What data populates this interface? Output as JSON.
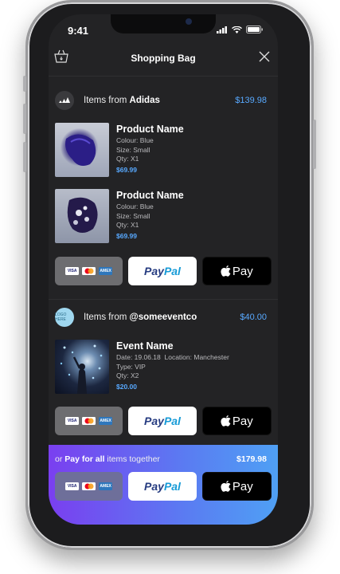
{
  "status_bar": {
    "time": "9:41"
  },
  "header": {
    "title": "Shopping Bag",
    "bag_icon": "shopping-bag-icon",
    "close_icon": "close-icon"
  },
  "shops": [
    {
      "label_prefix": "Items from",
      "name": "Adidas",
      "logo_text": "adidas",
      "total": "$139.98",
      "items": [
        {
          "name": "Product Name",
          "colour": "Colour: Blue",
          "size": "Size: Small",
          "qty": "Qty: X1",
          "price": "$69.99"
        },
        {
          "name": "Product Name",
          "colour": "Colour: Blue",
          "size": "Size: Small",
          "qty": "Qty: X1",
          "price": "$69.99"
        }
      ]
    },
    {
      "label_prefix": "Items from",
      "name": "@someeventco",
      "logo_text": "LOGO HERE",
      "total": "$40.00",
      "items": [
        {
          "name": "Event Name",
          "date": "Date: 19.06.18",
          "location": "Location: Manchester",
          "type": "Type: VIP",
          "qty": "Qty: X2",
          "price": "$20.00"
        }
      ]
    }
  ],
  "payment": {
    "cards": [
      "VISA",
      "MC",
      "AMEX"
    ],
    "paypal_part1": "Pay",
    "paypal_part2": "Pal",
    "apple_pay": "Pay"
  },
  "bottom": {
    "prefix": "or",
    "bold": "Pay for all",
    "suffix": "items together",
    "total": "$179.98"
  },
  "colors": {
    "accent": "#58a9ff",
    "gradient_start": "#7a3ff0",
    "gradient_end": "#4fa0f4"
  }
}
